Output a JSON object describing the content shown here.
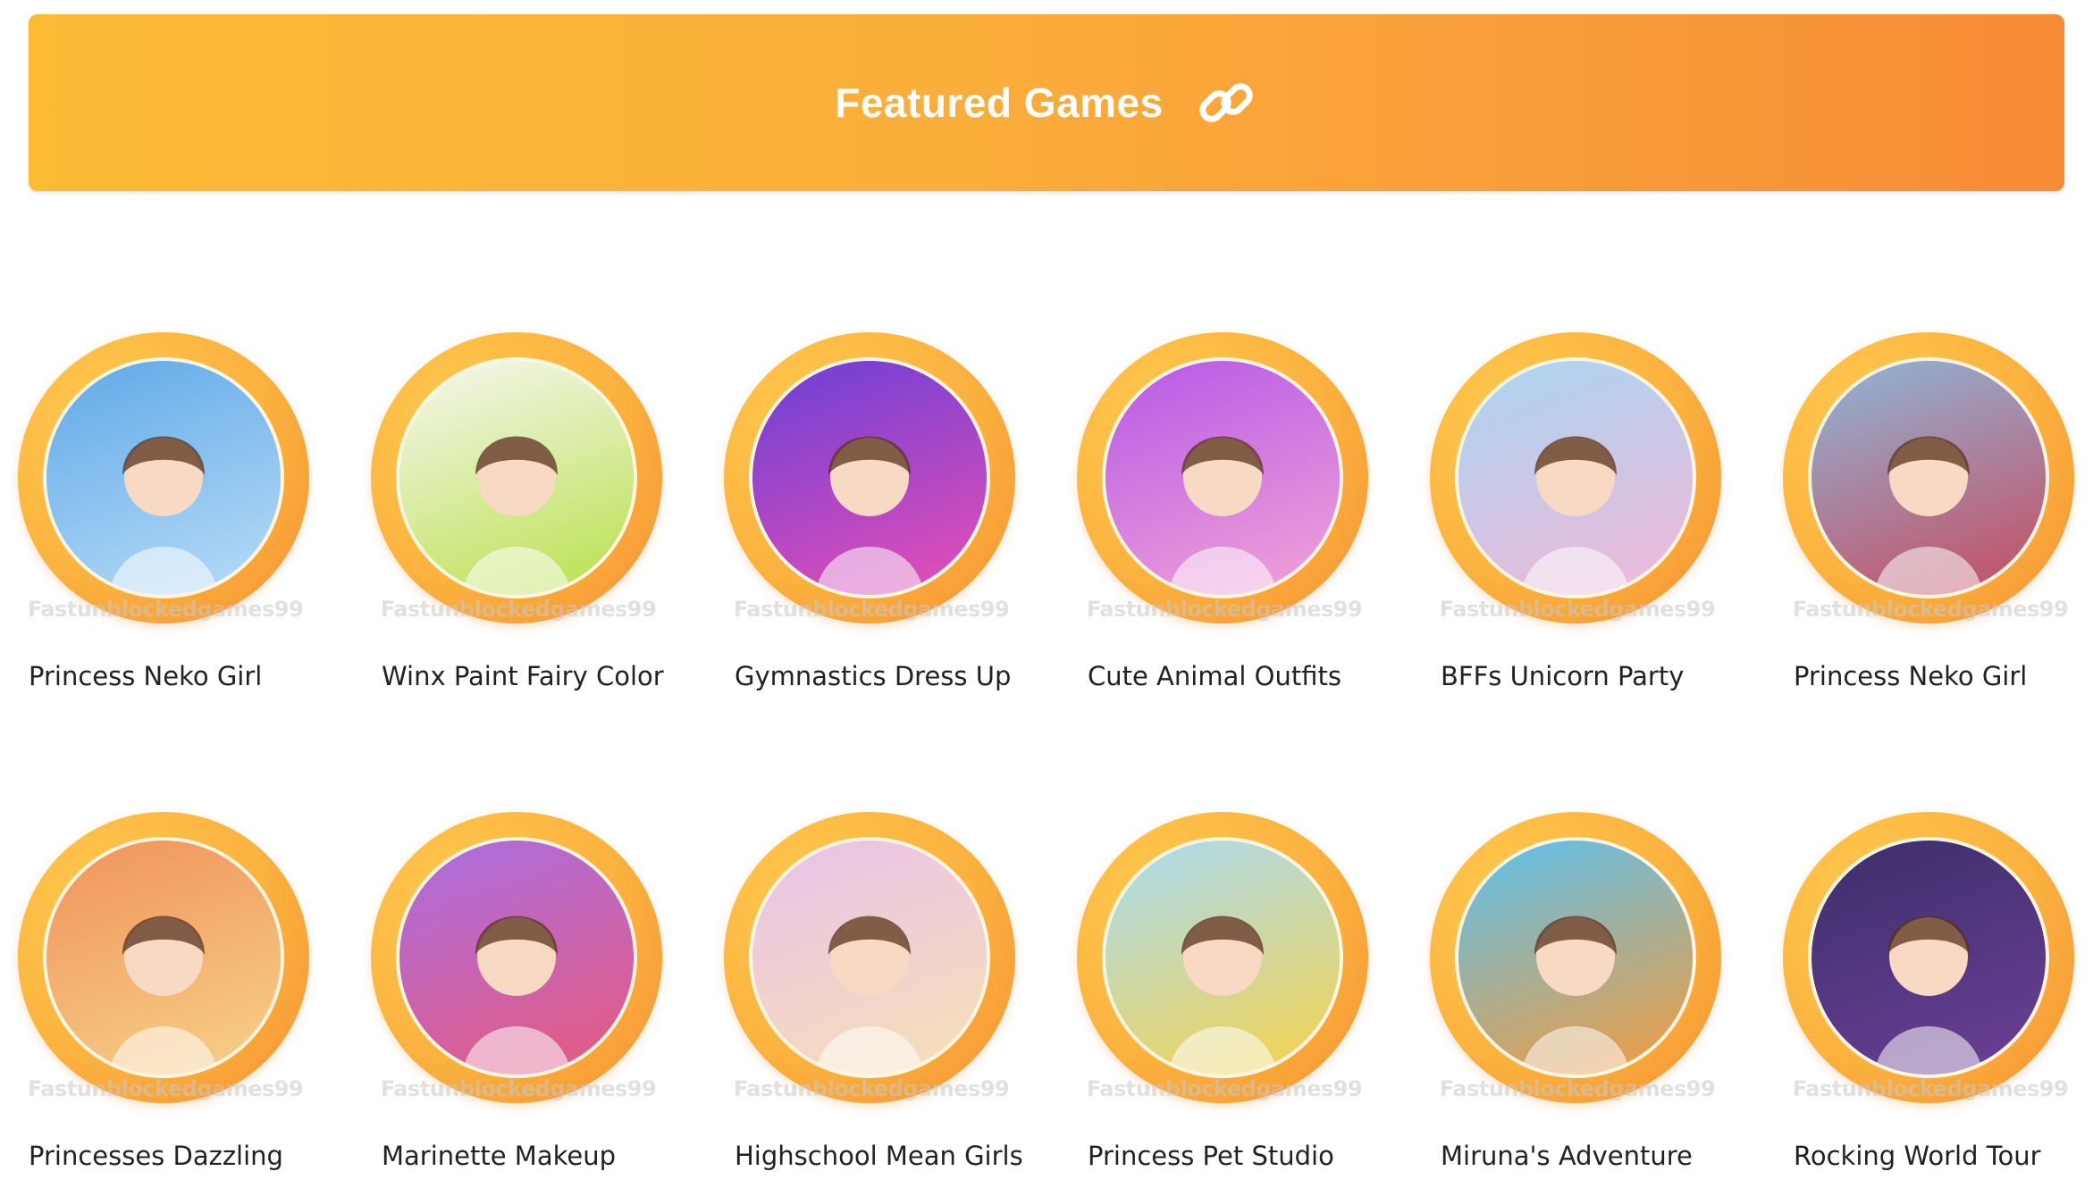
{
  "banner": {
    "title": "Featured Games",
    "icon": "link-icon",
    "gradient_start": "#fbbb35",
    "gradient_end": "#f78c37"
  },
  "watermark_text": "Fastunblockedgames99",
  "games": [
    {
      "title": "Princess Neko Girl",
      "thumb_colors": [
        "#5fa9e8",
        "#b9dcf7"
      ]
    },
    {
      "title": "Winx Paint Fairy Color",
      "thumb_colors": [
        "#f7f7f2",
        "#b8e04a"
      ]
    },
    {
      "title": "Gymnastics Dress Up",
      "thumb_colors": [
        "#6a3fd6",
        "#e94fb6"
      ]
    },
    {
      "title": "Cute Animal Outfits",
      "thumb_colors": [
        "#b659e8",
        "#f2a4d6"
      ]
    },
    {
      "title": "BFFs Unicorn Party",
      "thumb_colors": [
        "#a8d6f2",
        "#f3b7d8"
      ]
    },
    {
      "title": "Princess Neko Girl",
      "thumb_colors": [
        "#8fb6d8",
        "#c74b5f"
      ]
    },
    {
      "title": "Princesses Dazzling",
      "thumb_colors": [
        "#f0925b",
        "#f7d28a"
      ]
    },
    {
      "title": "Marinette Makeup",
      "thumb_colors": [
        "#a96ee3",
        "#e85a7c"
      ]
    },
    {
      "title": "Highschool Mean Girls",
      "thumb_colors": [
        "#e9c2ea",
        "#f7e0b5"
      ]
    },
    {
      "title": "Princess Pet Studio",
      "thumb_colors": [
        "#a9dbf3",
        "#f6d34c"
      ]
    },
    {
      "title": "Miruna's Adventure",
      "thumb_colors": [
        "#5bc2f0",
        "#f59a3a"
      ]
    },
    {
      "title": "Rocking World Tour",
      "thumb_colors": [
        "#3b2f6b",
        "#6d3f96"
      ]
    }
  ]
}
